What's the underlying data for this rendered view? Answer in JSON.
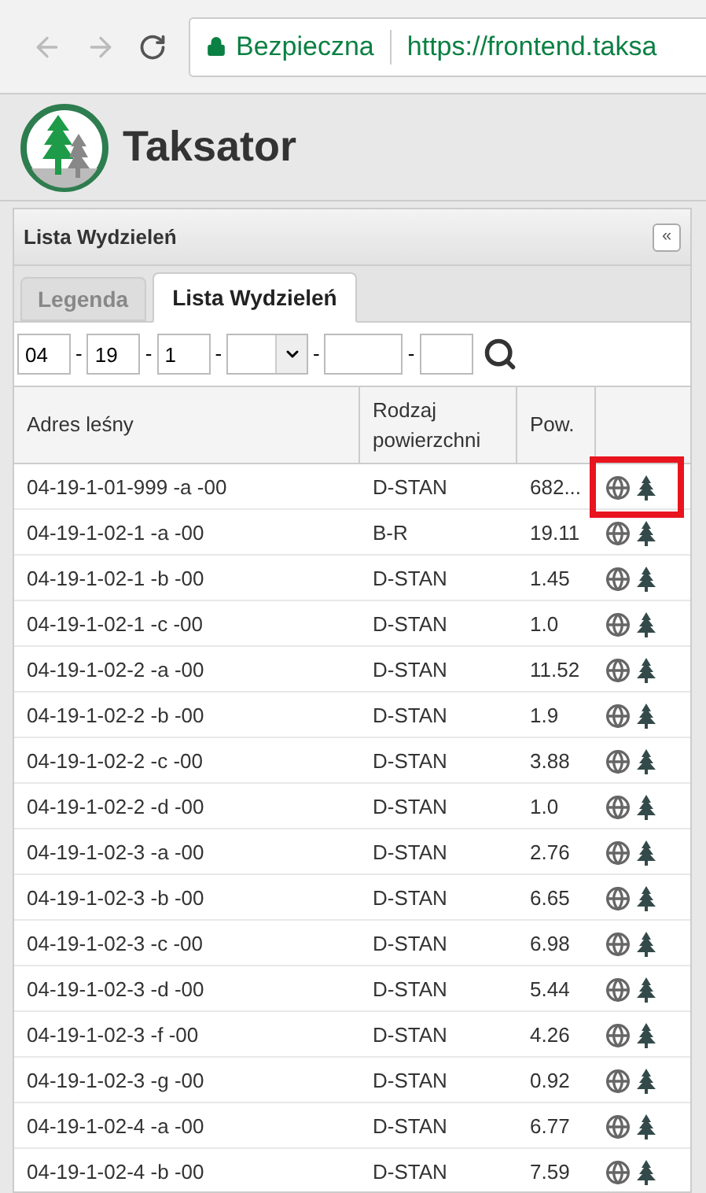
{
  "browser": {
    "security": "Bezpieczna",
    "url": "https://frontend.taksa"
  },
  "app": {
    "title": "Taksator"
  },
  "panel": {
    "title": "Lista Wydzieleń",
    "collapse": "«"
  },
  "tabs": [
    {
      "label": "Legenda",
      "selected": false
    },
    {
      "label": "Lista Wydzieleń",
      "selected": true
    }
  ],
  "filter": {
    "fields": [
      {
        "kind": "text",
        "value": "04"
      },
      {
        "kind": "text",
        "value": "19"
      },
      {
        "kind": "text",
        "value": "1"
      },
      {
        "kind": "select"
      },
      {
        "kind": "wide"
      },
      {
        "kind": "text"
      }
    ],
    "separator": "-"
  },
  "table": {
    "columns": [
      "Adres leśny",
      "Rodzaj powierzchni",
      "Pow.",
      ""
    ],
    "rows": [
      {
        "address": "04-19-1-01-999 -a -00",
        "type": "D-STAN",
        "area": "682...",
        "highlighted": true
      },
      {
        "address": "04-19-1-02-1 -a -00",
        "type": "B-R",
        "area": "19.11",
        "highlighted": false
      },
      {
        "address": "04-19-1-02-1 -b -00",
        "type": "D-STAN",
        "area": "1.45",
        "highlighted": false
      },
      {
        "address": "04-19-1-02-1 -c -00",
        "type": "D-STAN",
        "area": "1.0",
        "highlighted": false
      },
      {
        "address": "04-19-1-02-2 -a -00",
        "type": "D-STAN",
        "area": "11.52",
        "highlighted": false
      },
      {
        "address": "04-19-1-02-2 -b -00",
        "type": "D-STAN",
        "area": "1.9",
        "highlighted": false
      },
      {
        "address": "04-19-1-02-2 -c -00",
        "type": "D-STAN",
        "area": "3.88",
        "highlighted": false
      },
      {
        "address": "04-19-1-02-2 -d -00",
        "type": "D-STAN",
        "area": "1.0",
        "highlighted": false
      },
      {
        "address": "04-19-1-02-3 -a -00",
        "type": "D-STAN",
        "area": "2.76",
        "highlighted": false
      },
      {
        "address": "04-19-1-02-3 -b -00",
        "type": "D-STAN",
        "area": "6.65",
        "highlighted": false
      },
      {
        "address": "04-19-1-02-3 -c -00",
        "type": "D-STAN",
        "area": "6.98",
        "highlighted": false
      },
      {
        "address": "04-19-1-02-3 -d -00",
        "type": "D-STAN",
        "area": "5.44",
        "highlighted": false
      },
      {
        "address": "04-19-1-02-3 -f -00",
        "type": "D-STAN",
        "area": "4.26",
        "highlighted": false
      },
      {
        "address": "04-19-1-02-3 -g -00",
        "type": "D-STAN",
        "area": "0.92",
        "highlighted": false
      },
      {
        "address": "04-19-1-02-4 -a -00",
        "type": "D-STAN",
        "area": "6.77",
        "highlighted": false
      },
      {
        "address": "04-19-1-02-4 -b -00",
        "type": "D-STAN",
        "area": "7.59",
        "highlighted": false
      }
    ]
  }
}
